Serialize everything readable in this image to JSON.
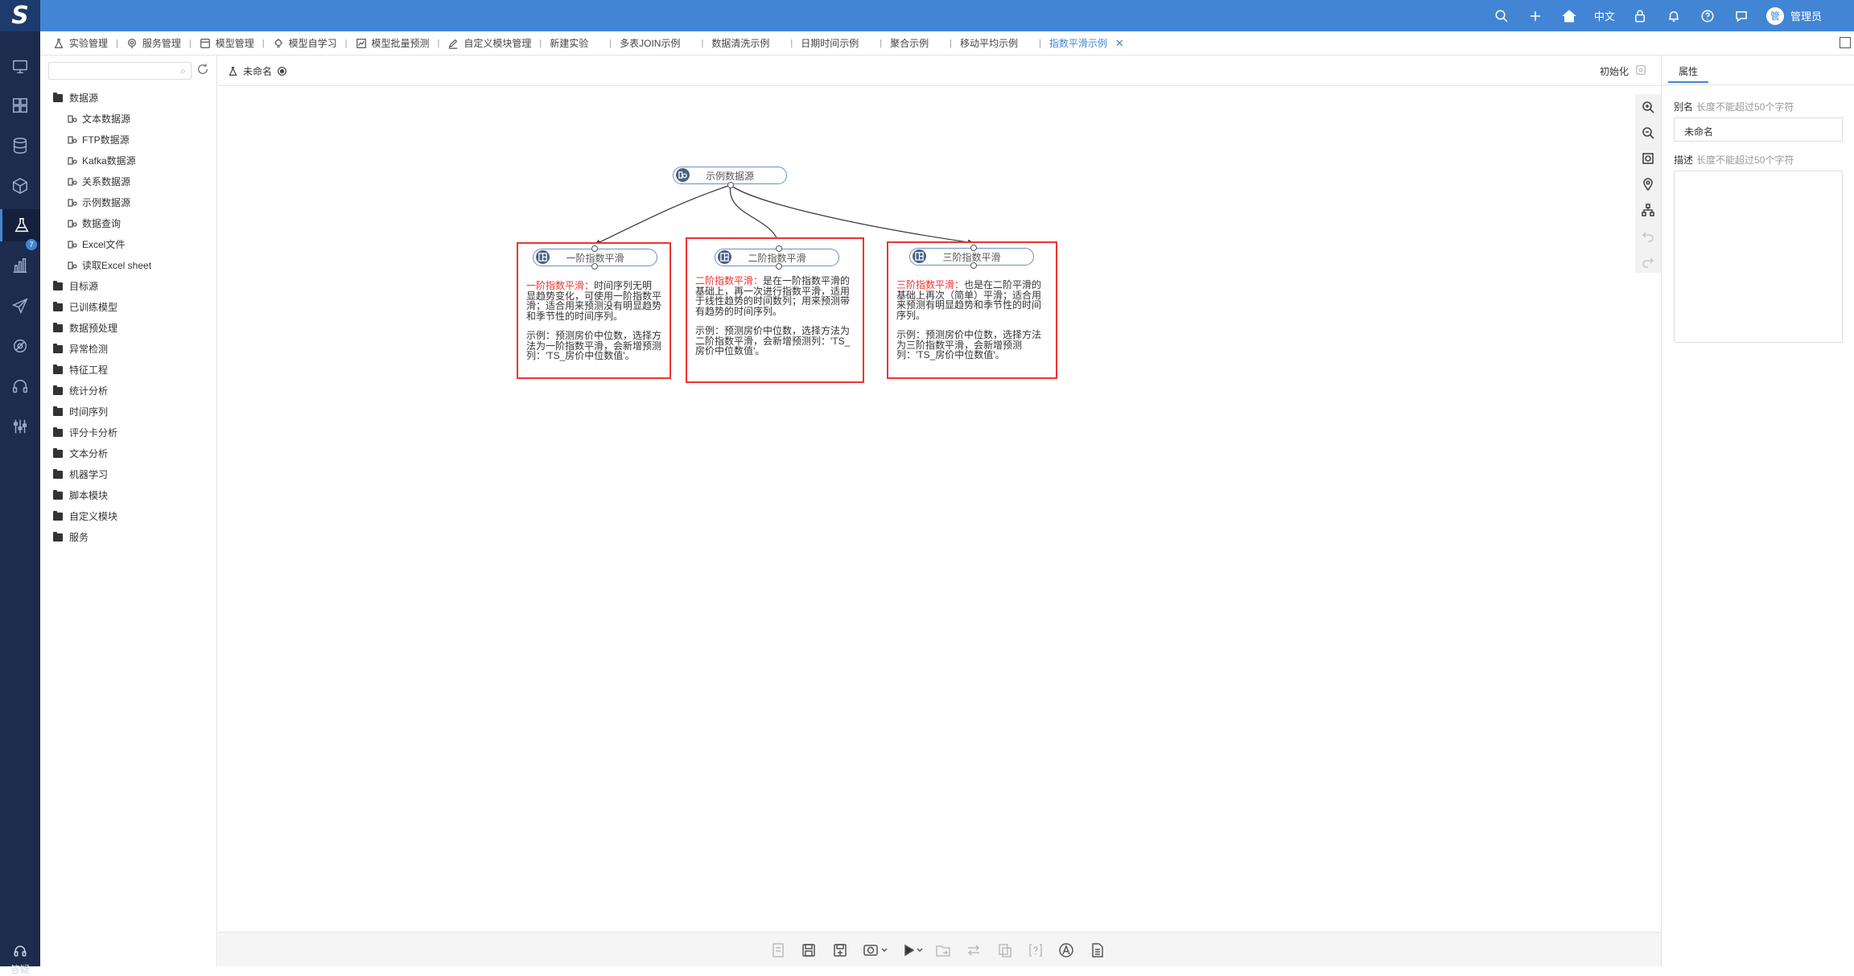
{
  "header": {
    "logo": "S",
    "lang": "中文",
    "avatar_text": "管",
    "username": "管理员",
    "icons": [
      "search-icon",
      "plus-icon",
      "home-icon",
      "lock-icon",
      "bell-icon",
      "help-icon",
      "chat-icon"
    ]
  },
  "left_nav": {
    "items": [
      "monitor-icon",
      "dashboard-icon",
      "database-icon",
      "cube-icon",
      "experiment-icon",
      "chart-icon",
      "send-icon",
      "model-icon",
      "headset-icon",
      "tools-icon"
    ],
    "active_index": 4,
    "badge": "7",
    "help_label": "答疑"
  },
  "tabs": [
    {
      "label": "实验管理",
      "icon": "flask-icon"
    },
    {
      "label": "服务管理",
      "icon": "service-icon"
    },
    {
      "label": "模型管理",
      "icon": "model-icon"
    },
    {
      "label": "模型自学习",
      "icon": "bulb-icon"
    },
    {
      "label": "模型批量预测",
      "icon": "chart-icon"
    },
    {
      "label": "自定义模块管理",
      "icon": "edit-icon"
    },
    {
      "label": "新建实验",
      "icon": ""
    },
    {
      "label": "多表JOIN示例",
      "icon": ""
    },
    {
      "label": "数据清洗示例",
      "icon": ""
    },
    {
      "label": "日期时间示例",
      "icon": ""
    },
    {
      "label": "聚合示例",
      "icon": ""
    },
    {
      "label": "移动平均示例",
      "icon": ""
    },
    {
      "label": "指数平滑示例",
      "icon": "",
      "active": true
    }
  ],
  "tree": {
    "search_placeholder": "",
    "root": "数据源",
    "datasource_children": [
      "文本数据源",
      "FTP数据源",
      "Kafka数据源",
      "关系数据源",
      "示例数据源",
      "数据查询",
      "Excel文件",
      "读取Excel sheet"
    ],
    "folders": [
      "目标源",
      "已训练模型",
      "数据预处理",
      "异常检测",
      "特征工程",
      "统计分析",
      "时间序列",
      "评分卡分析",
      "文本分析",
      "机器学习",
      "脚本模块",
      "自定义模块",
      "服务"
    ]
  },
  "canvas": {
    "workflow_name": "未命名",
    "init_label": "初始化",
    "source_node": "示例数据源",
    "nodes": [
      "一阶指数平滑",
      "二阶指数平滑",
      "三阶指数平滑"
    ],
    "notes": [
      {
        "title": "一阶指数平滑：",
        "body": "时间序列无明显趋势变化，可使用一阶指数平滑；适合用来预测没有明显趋势和季节性的时间序列。",
        "example": "示例：预测房价中位数，选择方法为一阶指数平滑，会新增预测列：'TS_房价中位数值'。"
      },
      {
        "title": "二阶指数平滑：",
        "body": "是在一阶指数平滑的基础上，再一次进行指数平滑，适用于线性趋势的时间数列；用来预测带有趋势的时间序列。",
        "example": "示例：预测房价中位数，选择方法为二阶指数平滑，会新增预测列：'TS_房价中位数值'。"
      },
      {
        "title": "三阶指数平滑：",
        "body": "也是在二阶平滑的基础上再次（简单）平滑；适合用来预测有明显趋势和季节性的时间序列。",
        "example": "示例：预测房价中位数，选择方法为三阶指数平滑，会新增预测列：'TS_房价中位数值'。"
      }
    ]
  },
  "props": {
    "tab": "属性",
    "alias_label": "别名",
    "alias_hint": "长度不能超过50个字符",
    "alias_value": "未命名",
    "desc_label": "描述",
    "desc_hint": "长度不能超过50个字符"
  },
  "colors": {
    "accent": "#4285d4",
    "nav_bg": "#1d2b4e",
    "note_border": "#ee3333"
  }
}
